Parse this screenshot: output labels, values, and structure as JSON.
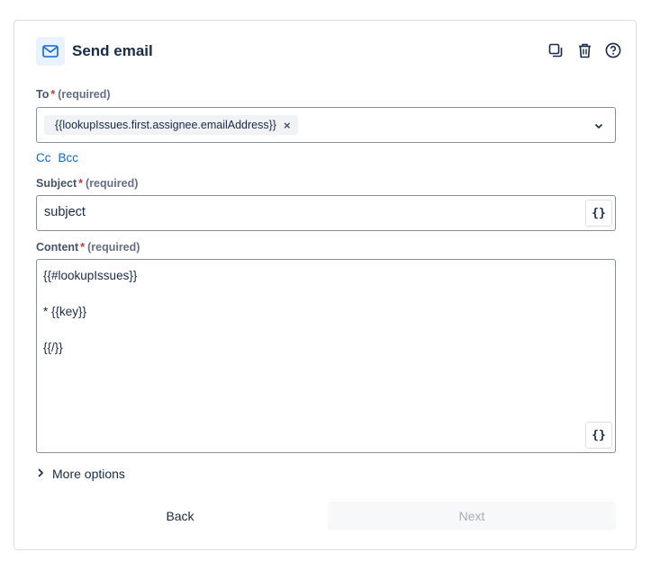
{
  "header": {
    "title": "Send email",
    "icon": "mail-icon",
    "accent": "#0c66e4"
  },
  "actions": {
    "duplicate_icon": "duplicate-icon",
    "delete_icon": "trash-icon",
    "help_icon": "help-icon"
  },
  "to": {
    "label": "To",
    "required_mark": "*",
    "required_hint": "(required)",
    "tag_value": "{{lookupIssues.first.assignee.emailAddress}}",
    "tag_remove": "×"
  },
  "links": {
    "cc": "Cc",
    "bcc": "Bcc"
  },
  "subject": {
    "label": "Subject",
    "required_mark": "*",
    "required_hint": "(required)",
    "value": "subject",
    "var_button": "{}"
  },
  "content": {
    "label": "Content",
    "required_mark": "*",
    "required_hint": "(required)",
    "lines": [
      "{{#lookupIssues}}",
      "",
      "* {{key}}",
      "",
      "{{/}}"
    ],
    "var_button": "{}"
  },
  "more_options": {
    "label": "More options"
  },
  "footer": {
    "back_label": "Back",
    "next_label": "Next"
  }
}
